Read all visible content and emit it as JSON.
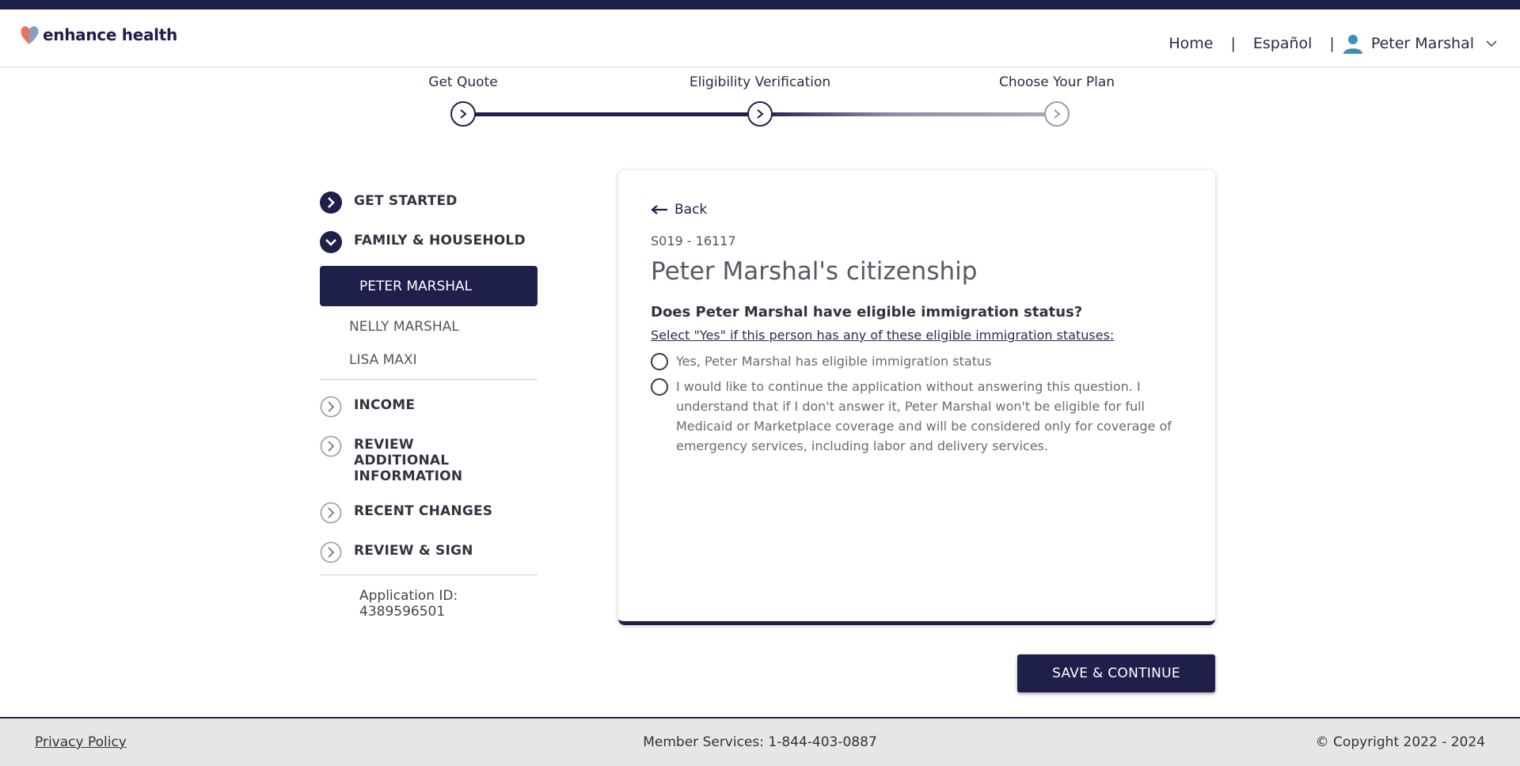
{
  "header": {
    "brand": "enhance health",
    "nav": {
      "home": "Home",
      "language": "Español",
      "separator": "|",
      "user_name": "Peter Marshal"
    }
  },
  "stepper": {
    "steps": [
      {
        "label": "Get Quote",
        "state": "done"
      },
      {
        "label": "Eligibility Verification",
        "state": "current"
      },
      {
        "label": "Choose Your Plan",
        "state": "upcoming"
      }
    ]
  },
  "sidebar": {
    "sections": {
      "get_started": "GET STARTED",
      "family_household": "FAMILY & HOUSEHOLD",
      "income": "INCOME",
      "review_additional": "REVIEW ADDITIONAL INFORMATION",
      "recent_changes": "RECENT CHANGES",
      "review_sign": "REVIEW & SIGN"
    },
    "members": {
      "active": "PETER MARSHAL",
      "second": "NELLY MARSHAL",
      "third": "LISA MAXI"
    },
    "application_id": "Application ID: 4389596501"
  },
  "card": {
    "back_label": "Back",
    "code": "S019 - 16117",
    "title": "Peter Marshal's citizenship",
    "question": "Does Peter Marshal have eligible immigration status?",
    "hint": "Select \"Yes\" if this person has any of these eligible immigration statuses:",
    "options": [
      "Yes, Peter Marshal has eligible immigration status",
      "I would like to continue the application without answering this question. I understand that if I don't answer it, Peter Marshal won't be eligible for full Medicaid or Marketplace coverage and will be considered only for coverage of emergency services, including labor and delivery services."
    ]
  },
  "actions": {
    "save_continue": "SAVE & CONTINUE"
  },
  "footer": {
    "privacy": "Privacy Policy",
    "member_services": "Member Services: 1-844-403-0887",
    "copyright": "© Copyright 2022 - 2024"
  },
  "colors": {
    "navy": "#1e1f4a",
    "brand_coral": "#e8755e",
    "brand_blue": "#7d93b8",
    "user_icon": "#3d8fb5"
  }
}
